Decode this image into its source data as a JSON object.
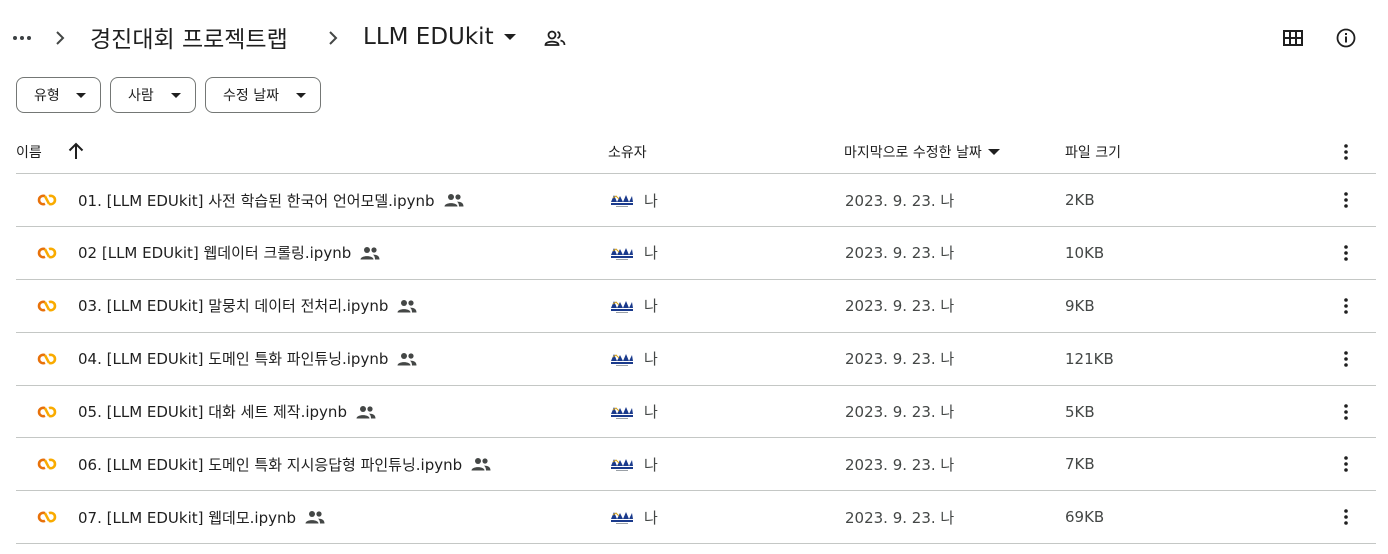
{
  "breadcrumb": {
    "more_icon": "more-horiz-icon",
    "separator_icon": "chevron-right-icon",
    "items": [
      {
        "label": "경진대회 프로젝트랩"
      },
      {
        "label": "LLM EDUkit",
        "has_dropdown": true,
        "shared_icon": "shared-folder-icon"
      }
    ]
  },
  "toolbar": {
    "grid_view_icon": "grid-view-icon",
    "info_icon": "info-icon"
  },
  "filters": [
    {
      "label": "유형"
    },
    {
      "label": "사람"
    },
    {
      "label": "수정 날짜"
    }
  ],
  "table": {
    "columns": {
      "name": "이름",
      "owner": "소유자",
      "modified": "마지막으로 수정한 날짜",
      "size": "파일 크기"
    },
    "sort": {
      "column": "name",
      "direction": "ascending",
      "icon": "arrow-upward-icon"
    },
    "rows": [
      {
        "name": "01. [LLM EDUkit] 사전 학습된 한국어 언어모델.ipynb",
        "owner": "나",
        "modified": "2023. 9. 23. 나",
        "size": "2KB"
      },
      {
        "name": "02 [LLM EDUkit] 웹데이터 크롤링.ipynb",
        "owner": "나",
        "modified": "2023. 9. 23. 나",
        "size": "10KB"
      },
      {
        "name": "03. [LLM EDUkit] 말뭉치 데이터 전처리.ipynb",
        "owner": "나",
        "modified": "2023. 9. 23. 나",
        "size": "9KB"
      },
      {
        "name": "04. [LLM EDUkit] 도메인 특화 파인튜닝.ipynb",
        "owner": "나",
        "modified": "2023. 9. 23. 나",
        "size": "121KB"
      },
      {
        "name": "05. [LLM EDUkit] 대화 세트 제작.ipynb",
        "owner": "나",
        "modified": "2023. 9. 23. 나",
        "size": "5KB"
      },
      {
        "name": "06. [LLM EDUkit] 도메인 특화 지시응답형 파인튜닝.ipynb",
        "owner": "나",
        "modified": "2023. 9. 23. 나",
        "size": "7KB"
      },
      {
        "name": "07. [LLM EDUkit] 웹데모.ipynb",
        "owner": "나",
        "modified": "2023. 9. 23. 나",
        "size": "69KB"
      }
    ]
  },
  "colors": {
    "text": "#1f1f1f",
    "secondary_text": "#444746",
    "divider": "#c4c7c5",
    "colab_orange": "#f9ab00",
    "colab_yellow": "#e8710a"
  }
}
